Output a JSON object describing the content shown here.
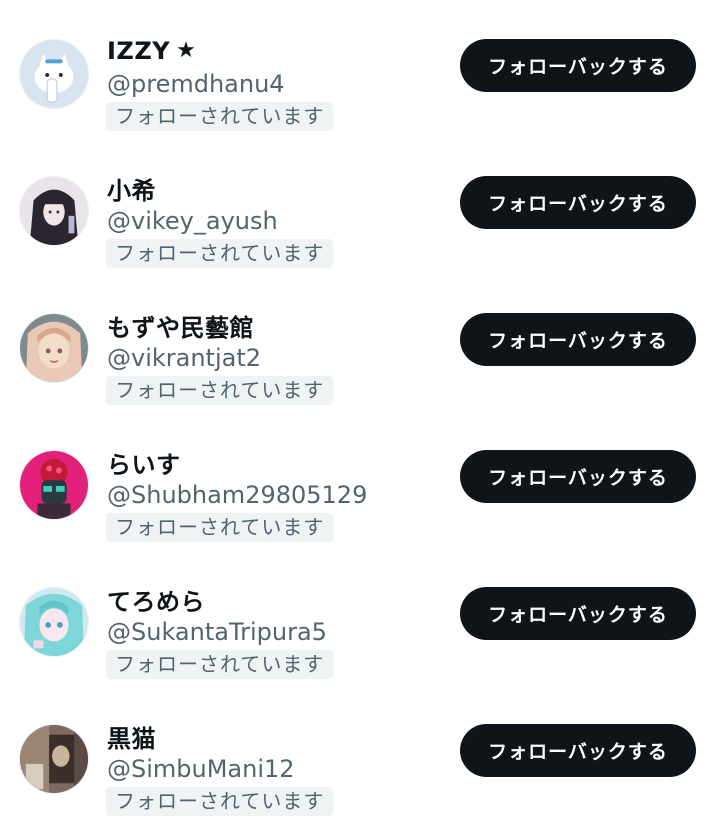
{
  "followers": [
    {
      "display_name": "IZZY",
      "badge_icon": "star-icon",
      "badge_glyph": "★",
      "handle": "@premdhanu4",
      "follows_you_label": "フォローされています",
      "button_label": "フォローバックする",
      "avatar": {
        "bg": "#d8e4ef",
        "fg": "#ffffff",
        "accent": "#5a9fd6"
      }
    },
    {
      "display_name": "小希",
      "handle": "@vikey_ayush",
      "follows_you_label": "フォローされています",
      "button_label": "フォローバックする",
      "avatar": {
        "bg": "#e9e4ea",
        "fg": "#2a2530",
        "accent": "#f3e6e8"
      }
    },
    {
      "display_name": "もずや民藝館",
      "handle": "@vikrantjat2",
      "follows_you_label": "フォローされています",
      "button_label": "フォローバックする",
      "avatar": {
        "bg": "#e9c9b6",
        "fg": "#f2ddc9",
        "accent": "#7f8a8e"
      }
    },
    {
      "display_name": "らいす",
      "handle": "@Shubham29805129",
      "follows_you_label": "フォローされています",
      "button_label": "フォローバックする",
      "avatar": {
        "bg": "#e3207a",
        "fg": "#2a3a3e",
        "accent": "#3ad0c0"
      }
    },
    {
      "display_name": "てろめら",
      "handle": "@SukantaTripura5",
      "follows_you_label": "フォローされています",
      "button_label": "フォローバックする",
      "avatar": {
        "bg": "#cfe9f1",
        "fg": "#7fd6d8",
        "accent": "#f6d9e6"
      }
    },
    {
      "display_name": "黒猫",
      "handle": "@SimbuMani12",
      "follows_you_label": "フォローされています",
      "button_label": "フォローバックする",
      "avatar": {
        "bg": "#7d6a62",
        "fg": "#c9b49f",
        "accent": "#3b2f2c"
      }
    }
  ],
  "colors": {
    "text_primary": "#0f1419",
    "text_secondary": "#536471",
    "badge_bg": "#eff3f4",
    "button_bg": "#0f1419",
    "button_text": "#ffffff",
    "page_bg": "#ffffff"
  }
}
